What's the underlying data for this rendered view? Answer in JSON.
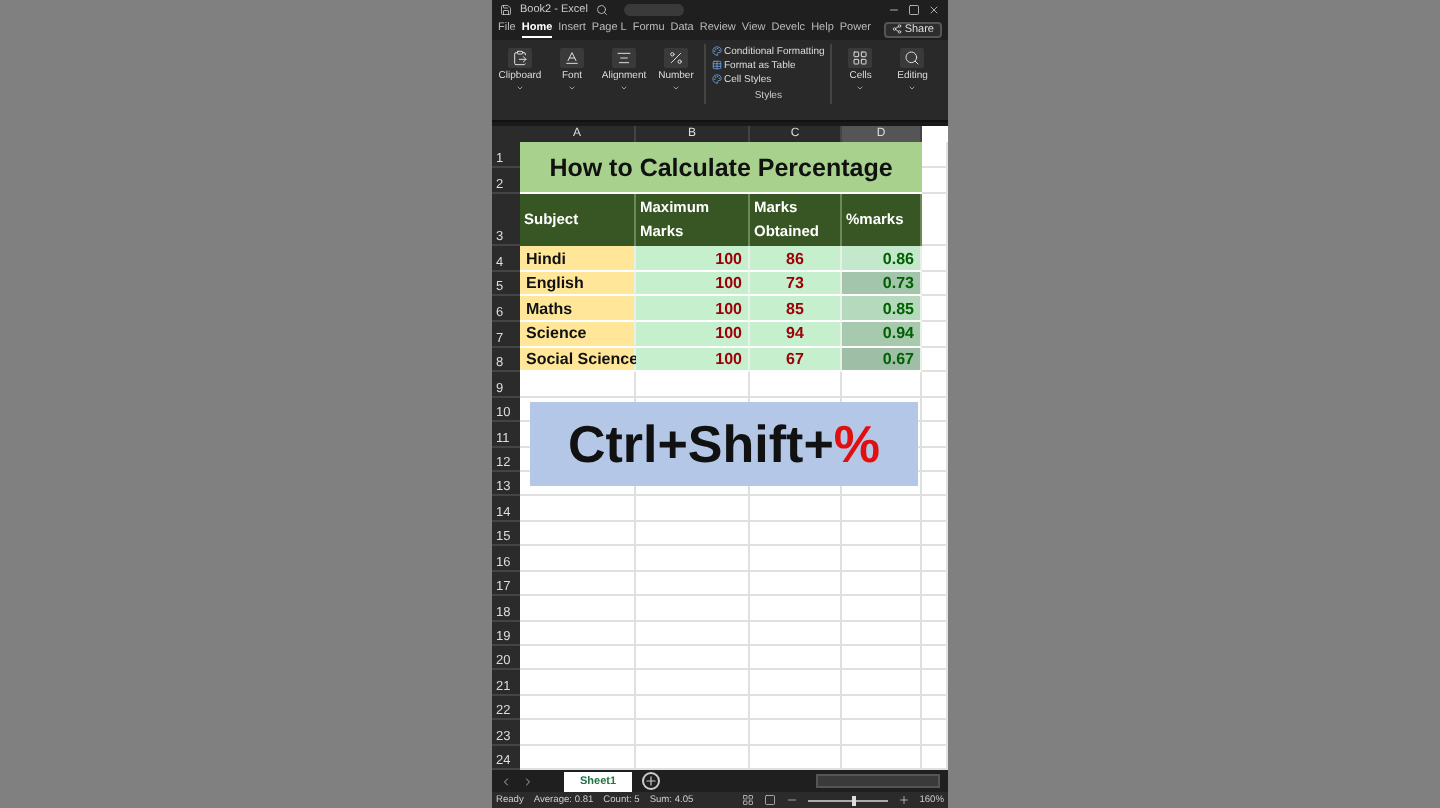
{
  "window": {
    "title": "Book2 - Excel"
  },
  "menu_tabs": [
    {
      "label": "File",
      "selected": false
    },
    {
      "label": "Home",
      "selected": true
    },
    {
      "label": "Insert",
      "selected": false
    },
    {
      "label": "Page L",
      "selected": false
    },
    {
      "label": "Formu",
      "selected": false
    },
    {
      "label": "Data",
      "selected": false
    },
    {
      "label": "Review",
      "selected": false
    },
    {
      "label": "View",
      "selected": false
    },
    {
      "label": "Develc",
      "selected": false
    },
    {
      "label": "Help",
      "selected": false
    },
    {
      "label": "Power",
      "selected": false
    }
  ],
  "share_button": "Share",
  "ribbon": {
    "groups": [
      {
        "kind": "button",
        "label": "Clipboard"
      },
      {
        "kind": "button",
        "label": "Font"
      },
      {
        "kind": "button",
        "label": "Alignment"
      },
      {
        "kind": "button",
        "label": "Number"
      },
      {
        "kind": "styles",
        "label": "Styles",
        "items": [
          "Conditional Formatting",
          "Format as Table",
          "Cell Styles"
        ]
      },
      {
        "kind": "button",
        "label": "Cells"
      },
      {
        "kind": "button",
        "label": "Editing"
      }
    ]
  },
  "sheet": {
    "columns": [
      {
        "label": "A",
        "selected": false
      },
      {
        "label": "B",
        "selected": false
      },
      {
        "label": "C",
        "selected": false
      },
      {
        "label": "D",
        "selected": true
      }
    ],
    "row_numbers": [
      "1",
      "2",
      "3",
      "4",
      "5",
      "6",
      "7",
      "8",
      "9",
      "10",
      "11",
      "12",
      "13",
      "14",
      "15",
      "16",
      "17",
      "18",
      "19",
      "20",
      "21",
      "22",
      "23",
      "24"
    ],
    "title": "How to Calculate Percentage",
    "headers": [
      "Subject",
      "Maximum Marks",
      "Marks Obtained",
      "%marks"
    ],
    "rows": [
      {
        "subject": "Hindi",
        "maximum": "100",
        "obtained": "86",
        "percent": "0.86",
        "color": "#c4e8cc"
      },
      {
        "subject": "English",
        "maximum": "100",
        "obtained": "73",
        "percent": "0.73",
        "color": "#a3c5ab"
      },
      {
        "subject": "Maths",
        "maximum": "100",
        "obtained": "85",
        "percent": "0.85",
        "color": "#b5d9bd"
      },
      {
        "subject": "Science",
        "maximum": "100",
        "obtained": "94",
        "percent": "0.94",
        "color": "#a7caaf"
      },
      {
        "subject": "Social Science",
        "maximum": "100",
        "obtained": "67",
        "percent": "0.67",
        "color": "#9ebea6"
      }
    ],
    "shortcut": {
      "text": "Ctrl+Shift+",
      "accent": "%"
    }
  },
  "sheet_tabs": [
    {
      "label": "Sheet1",
      "selected": true
    }
  ],
  "status_bar": {
    "state": "Ready",
    "stats": [
      "Average: 0.81",
      "Count: 5",
      "Sum: 4.05"
    ],
    "zoom": "160%",
    "zoom_slider": {
      "level": 0.55
    }
  }
}
